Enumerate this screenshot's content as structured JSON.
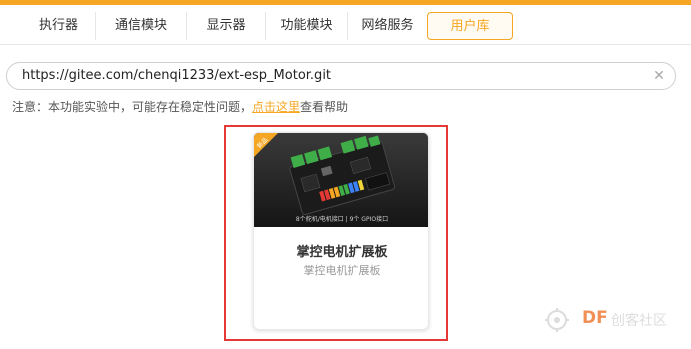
{
  "tabs": [
    {
      "label": "执行器",
      "active": false
    },
    {
      "label": "通信模块",
      "active": false
    },
    {
      "label": "显示器",
      "active": false
    },
    {
      "label": "功能模块",
      "active": false
    },
    {
      "label": "网络服务",
      "active": false
    },
    {
      "label": "用户库",
      "active": true
    }
  ],
  "search": {
    "value": "https://gitee.com/chenqi1233/ext-esp_Motor.git",
    "clear_icon": "close-icon",
    "clear_glyph": "✕"
  },
  "notice": {
    "prefix": "注意：本功能实验中，可能存在稳定性问题，",
    "link": "点击这里",
    "suffix": "查看帮助"
  },
  "card": {
    "ribbon": "新品",
    "image_caption": "8个舵机/电机接口 | 9个 GPIO接口",
    "title": "掌控电机扩展板",
    "subtitle": "掌控电机扩展板"
  },
  "watermark": {
    "brand": "DF",
    "text": "创客社区"
  },
  "colors": {
    "accent": "#f5a623",
    "highlight": "#e53935",
    "pcb": "#1b1b1b",
    "terminal": "#3fae49"
  }
}
